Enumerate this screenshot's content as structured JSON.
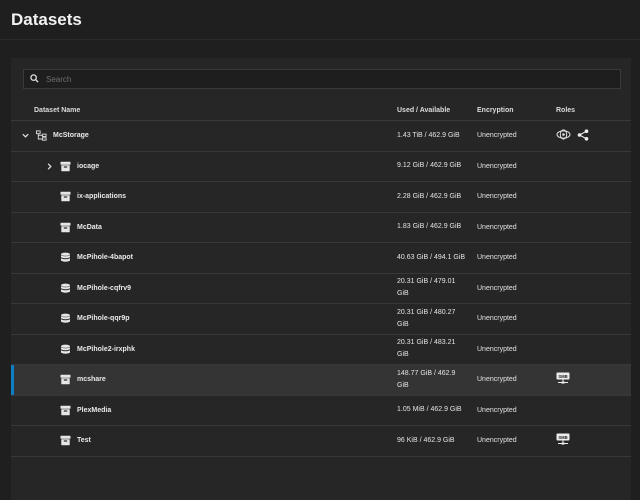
{
  "page": {
    "title": "Datasets"
  },
  "search": {
    "placeholder": "Search"
  },
  "table": {
    "headers": {
      "name": "Dataset Name",
      "used": "Used / Available",
      "encryption": "Encryption",
      "roles": "Roles"
    },
    "rows": [
      {
        "name": "McStorage",
        "used": "1.43 TiB / 462.9 GiB",
        "encryption": "Unencrypted",
        "icon": "pool-tree-icon",
        "expander": "chevron-down-icon",
        "roles": [
          "apps-role-icon",
          "share-icon"
        ]
      },
      {
        "name": "iocage",
        "used": "9.12 GiB / 462.9 GiB",
        "encryption": "Unencrypted",
        "icon": "dataset-icon",
        "expander": "chevron-right-icon",
        "roles": []
      },
      {
        "name": "ix-applications",
        "used": "2.28 GiB / 462.9 GiB",
        "encryption": "Unencrypted",
        "icon": "dataset-icon",
        "roles": []
      },
      {
        "name": "McData",
        "used": "1.83 GiB / 462.9 GiB",
        "encryption": "Unencrypted",
        "icon": "dataset-icon",
        "roles": []
      },
      {
        "name": "McPihole-4bapot",
        "used": "40.63 GiB / 494.1 GiB",
        "encryption": "Unencrypted",
        "icon": "zvol-icon",
        "roles": []
      },
      {
        "name": "McPihole-cqfrv9",
        "used": "20.31 GiB / 479.01 GiB",
        "encryption": "Unencrypted",
        "icon": "zvol-icon",
        "roles": []
      },
      {
        "name": "McPihole-qqr9p",
        "used": "20.31 GiB / 480.27 GiB",
        "encryption": "Unencrypted",
        "icon": "zvol-icon",
        "roles": []
      },
      {
        "name": "McPihole2-irxphk",
        "used": "20.31 GiB / 483.21 GiB",
        "encryption": "Unencrypted",
        "icon": "zvol-icon",
        "roles": []
      },
      {
        "name": "mcshare",
        "used": "148.77 GiB / 462.9 GiB",
        "encryption": "Unencrypted",
        "icon": "dataset-icon",
        "roles": [
          "smb-share-icon"
        ],
        "selected": true
      },
      {
        "name": "PlexMedia",
        "used": "1.05 MiB / 462.9 GiB",
        "encryption": "Unencrypted",
        "icon": "dataset-icon",
        "roles": []
      },
      {
        "name": "Test",
        "used": "96 KiB / 462.9 GiB",
        "encryption": "Unencrypted",
        "icon": "dataset-icon",
        "roles": [
          "smb-share-icon"
        ]
      }
    ]
  },
  "colors": {
    "background": "#1f1f1f",
    "panel": "#262626",
    "selection_accent": "#0d7ec4"
  }
}
